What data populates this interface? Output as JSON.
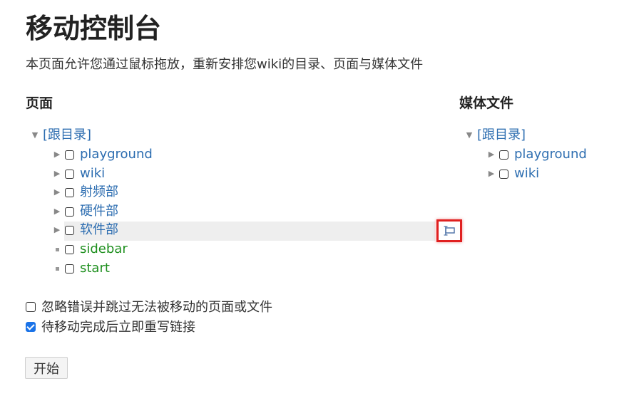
{
  "page": {
    "title": "移动控制台",
    "intro": "本页面允许您通过鼠标拖放，重新安排您wiki的目录、页面与媒体文件"
  },
  "pages_section": {
    "title": "页面",
    "root": "[跟目录]",
    "items": [
      {
        "label": "playground",
        "type": "namespace"
      },
      {
        "label": "wiki",
        "type": "namespace"
      },
      {
        "label": "射频部",
        "type": "namespace"
      },
      {
        "label": "硬件部",
        "type": "namespace"
      },
      {
        "label": "软件部",
        "type": "namespace"
      },
      {
        "label": "sidebar",
        "type": "page"
      },
      {
        "label": "start",
        "type": "page"
      }
    ]
  },
  "media_section": {
    "title": "媒体文件",
    "root": "[跟目录]",
    "items": [
      {
        "label": "playground",
        "type": "namespace"
      },
      {
        "label": "wiki",
        "type": "namespace"
      }
    ]
  },
  "options": {
    "skip_errors": {
      "label": "忽略错误并跳过无法被移动的页面或文件",
      "checked": false
    },
    "rewrite_links": {
      "label": "待移动完成后立即重写链接",
      "checked": true
    }
  },
  "buttons": {
    "start": "开始"
  },
  "icons": {
    "move_handle": "rename-handle-icon"
  },
  "colors": {
    "link": "#2b6cb0",
    "page_link": "#1e8f1e",
    "highlight": "#e02020"
  }
}
